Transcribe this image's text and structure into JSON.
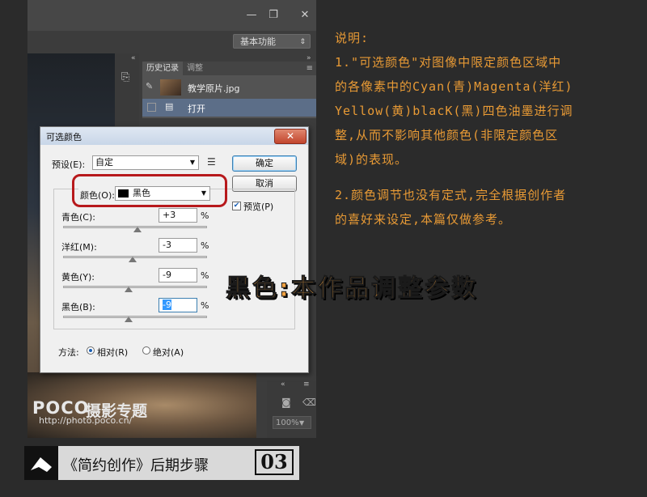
{
  "workspace": {
    "label": "基本功能"
  },
  "window_controls": {
    "minimize": "—",
    "restore": "❐",
    "close": "✕"
  },
  "history_panel": {
    "tabs": [
      "历史记录",
      "调整"
    ],
    "items": [
      {
        "label": "教学原片.jpg"
      },
      {
        "label": "打开"
      }
    ]
  },
  "zoom": {
    "value": "100%"
  },
  "watermark": {
    "logo": "POCO",
    "logo_cn": "摄影专题",
    "url": "http://photo.poco.cn/"
  },
  "dialog": {
    "title": "可选颜色",
    "close": "✕",
    "preset_label": "预设(E):",
    "preset_value": "自定",
    "ok": "确定",
    "cancel": "取消",
    "preview_label": "预览(P)",
    "preview_checked": true,
    "color_label": "颜色(O):",
    "color_value": "黑色",
    "color_swatch": "#000000",
    "sliders": [
      {
        "label": "青色(C):",
        "value": "+3",
        "unit": "%",
        "level": 3
      },
      {
        "label": "洋红(M):",
        "value": "-3",
        "unit": "%",
        "level": -3
      },
      {
        "label": "黄色(Y):",
        "value": "-9",
        "unit": "%",
        "level": -9
      },
      {
        "label": "黑色(B):",
        "value": "-9",
        "unit": "%",
        "level": -9
      }
    ],
    "method_label": "方法:",
    "method_options": [
      "相对(R)",
      "绝对(A)"
    ],
    "method_selected": "相对(R)"
  },
  "notes": {
    "title": "说明:",
    "paragraph1_lines": [
      "1.\"可选颜色\"对图像中限定颜色区域中",
      "的各像素中的Cyan(青)Magenta(洋红)",
      "Yellow(黄)blacK(黑)四色油墨进行调",
      "整,从而不影响其他颜色(非限定颜色区",
      "域)的表现。"
    ],
    "paragraph2_lines": [
      "2.颜色调节也没有定式,完全根据创作者",
      "的喜好来设定,本篇仅做参考。"
    ]
  },
  "heading": "黑色:本作品调整参数",
  "banner": {
    "title": "《简约创作》后期步骤",
    "step": "03"
  },
  "colors": {
    "accent": "#e89a35",
    "highlight_ring": "#b7191c"
  }
}
